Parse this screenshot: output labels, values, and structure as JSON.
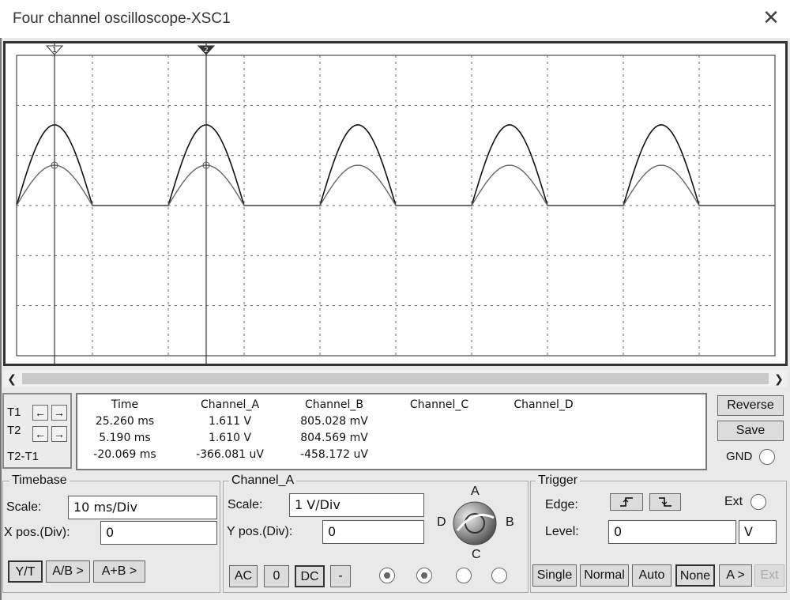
{
  "window": {
    "title": "Four channel oscilloscope-XSC1",
    "close_icon": "close-icon"
  },
  "scope": {
    "grid": true,
    "divisions": {
      "x": 10,
      "y": 6
    },
    "channel_a_peak": 1.611,
    "channel_b_peak": 0.805,
    "cursor_labels": {
      "t1": "1",
      "t2": "2"
    }
  },
  "scroll": {
    "left_icon": "arrow-left-icon",
    "right_icon": "arrow-right-icon"
  },
  "cursors": {
    "t1_label": "T1",
    "t2_label": "T2",
    "diff_label": "T2-T1",
    "left_arrow": "←",
    "right_arrow": "→"
  },
  "measurements": {
    "headers": {
      "time": "Time",
      "a": "Channel_A",
      "b": "Channel_B",
      "c": "Channel_C",
      "d": "Channel_D"
    },
    "rows": [
      {
        "time": "25.260 ms",
        "a": "1.611 V",
        "b": "805.028 mV"
      },
      {
        "time": "5.190 ms",
        "a": "1.610 V",
        "b": "804.569 mV"
      },
      {
        "time": "-20.069 ms",
        "a": "-366.081 uV",
        "b": "-458.172 uV"
      }
    ]
  },
  "side_buttons": {
    "reverse": "Reverse",
    "save": "Save",
    "gnd": "GND"
  },
  "timebase": {
    "title": "Timebase",
    "scale_label": "Scale:",
    "scale_value": "10 ms/Div",
    "xpos_label": "X pos.(Div):",
    "xpos_value": "0",
    "modes": [
      "Y/T",
      "A/B >",
      "A+B >"
    ]
  },
  "channel": {
    "title": "Channel_A",
    "scale_label": "Scale:",
    "scale_value": "1  V/Div",
    "ypos_label": "Y pos.(Div):",
    "ypos_value": "0",
    "coupling": [
      "AC",
      "0",
      "DC",
      "-"
    ],
    "knob_labels": {
      "a": "A",
      "b": "B",
      "c": "C",
      "d": "D"
    }
  },
  "trigger": {
    "title": "Trigger",
    "edge_label": "Edge:",
    "rising_icon": "rising-edge-icon",
    "falling_icon": "falling-edge-icon",
    "ext_label": "Ext",
    "level_label": "Level:",
    "level_value": "0",
    "level_unit": "V",
    "modes": [
      "Single",
      "Normal",
      "Auto",
      "None",
      "A >",
      "Ext"
    ]
  }
}
